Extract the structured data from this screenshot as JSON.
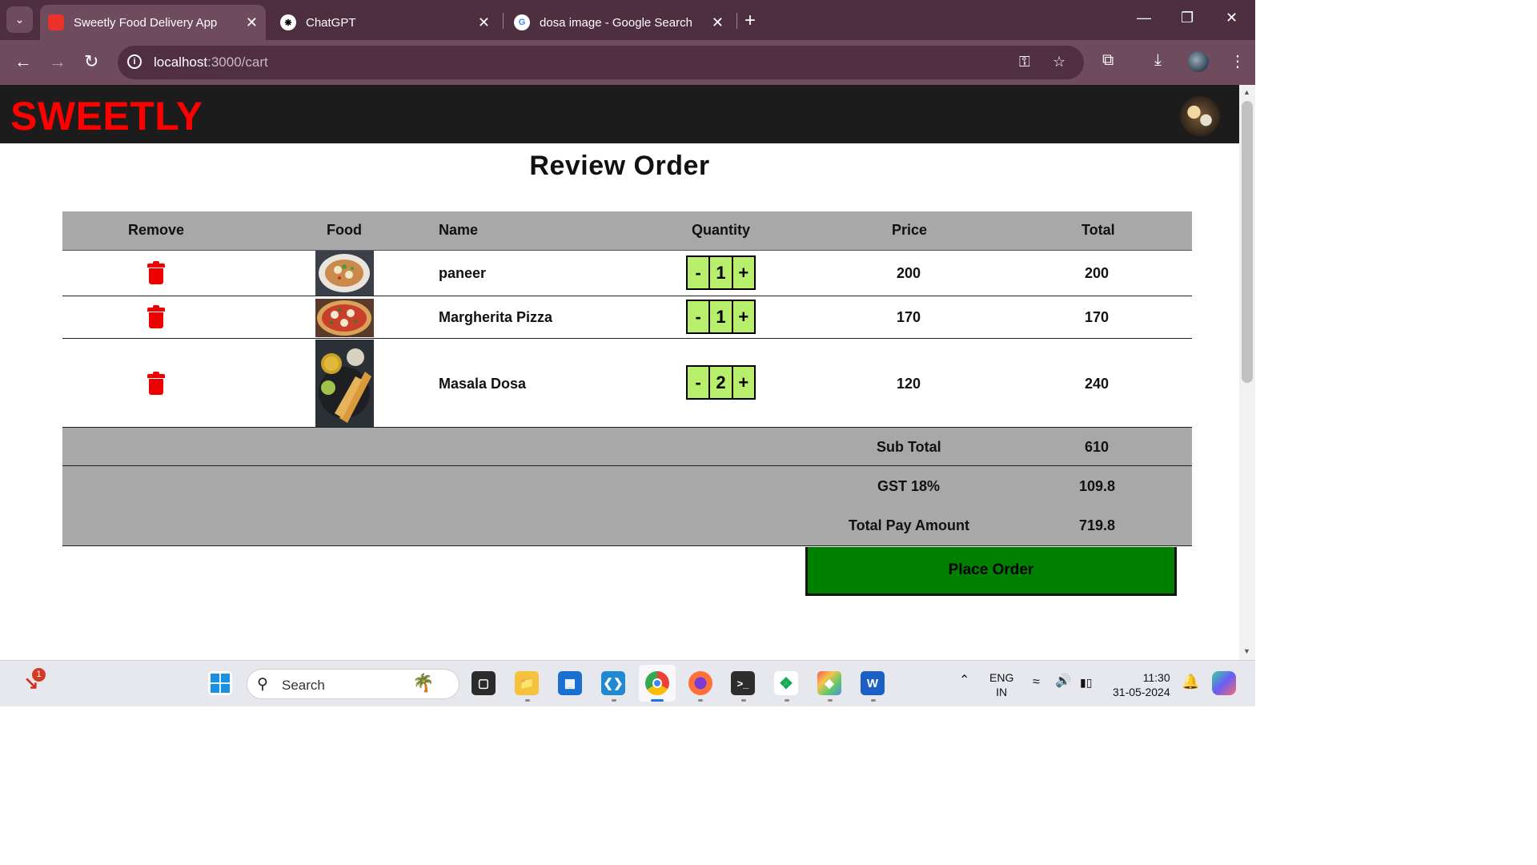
{
  "browser": {
    "tabs": [
      {
        "title": "Sweetly Food Delivery App",
        "favicon_color": "#e8322b",
        "active": true
      },
      {
        "title": "ChatGPT",
        "favicon_color": "#ffffff",
        "active": false
      },
      {
        "title": "dosa image - Google Search",
        "favicon_color": "#ffffff",
        "active": false
      }
    ],
    "url_host": "localhost",
    "url_path": ":3000/cart"
  },
  "app": {
    "brand": "SWEETLY",
    "brand_color": "#ff0000",
    "page_title": "Review Order"
  },
  "table": {
    "headers": {
      "remove": "Remove",
      "food": "Food",
      "name": "Name",
      "quantity": "Quantity",
      "price": "Price",
      "total": "Total"
    },
    "items": [
      {
        "name": "paneer",
        "quantity": "1",
        "price": "200",
        "total": "200",
        "image_icon": "paneer-dish-photo"
      },
      {
        "name": "Margherita Pizza",
        "quantity": "1",
        "price": "170",
        "total": "170",
        "image_icon": "pizza-photo"
      },
      {
        "name": "Masala Dosa",
        "quantity": "2",
        "price": "120",
        "total": "240",
        "image_icon": "dosa-photo"
      }
    ],
    "qty_minus": "-",
    "qty_plus": "+",
    "summary": {
      "subtotal_label": "Sub Total",
      "subtotal_value": "610",
      "gst_label": "GST 18%",
      "gst_value": "109.8",
      "total_label": "Total Pay Amount",
      "total_value": "719.8"
    },
    "place_order": "Place Order",
    "accent_green": "#008000",
    "qty_color": "#b7ef6c",
    "remove_color": "#ee0000"
  },
  "taskbar": {
    "search_placeholder": "Search",
    "notification_badge": "1",
    "lang_top": "ENG",
    "lang_bottom": "IN",
    "time": "11:30",
    "date": "31-05-2024"
  }
}
